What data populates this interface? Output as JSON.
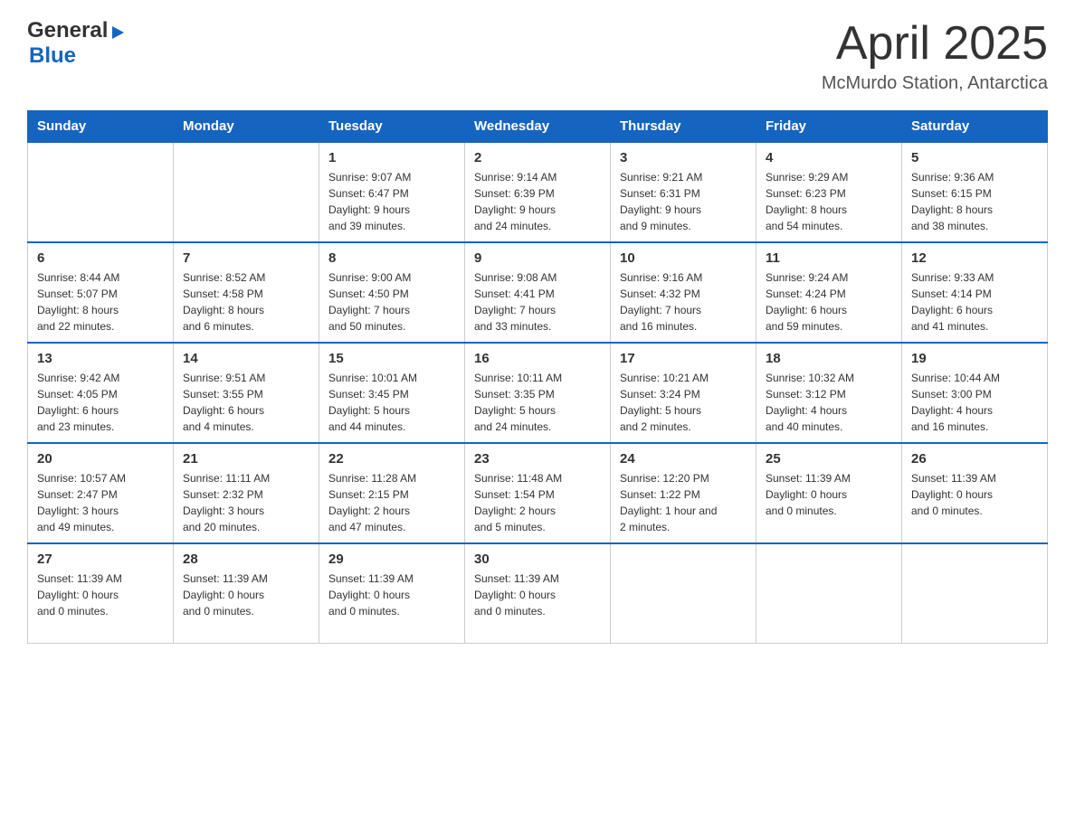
{
  "header": {
    "logo_general": "General",
    "logo_blue": "Blue",
    "title": "April 2025",
    "location": "McMurdo Station, Antarctica"
  },
  "weekdays": [
    "Sunday",
    "Monday",
    "Tuesday",
    "Wednesday",
    "Thursday",
    "Friday",
    "Saturday"
  ],
  "weeks": [
    [
      {
        "day": "",
        "info": ""
      },
      {
        "day": "",
        "info": ""
      },
      {
        "day": "1",
        "info": "Sunrise: 9:07 AM\nSunset: 6:47 PM\nDaylight: 9 hours\nand 39 minutes."
      },
      {
        "day": "2",
        "info": "Sunrise: 9:14 AM\nSunset: 6:39 PM\nDaylight: 9 hours\nand 24 minutes."
      },
      {
        "day": "3",
        "info": "Sunrise: 9:21 AM\nSunset: 6:31 PM\nDaylight: 9 hours\nand 9 minutes."
      },
      {
        "day": "4",
        "info": "Sunrise: 9:29 AM\nSunset: 6:23 PM\nDaylight: 8 hours\nand 54 minutes."
      },
      {
        "day": "5",
        "info": "Sunrise: 9:36 AM\nSunset: 6:15 PM\nDaylight: 8 hours\nand 38 minutes."
      }
    ],
    [
      {
        "day": "6",
        "info": "Sunrise: 8:44 AM\nSunset: 5:07 PM\nDaylight: 8 hours\nand 22 minutes."
      },
      {
        "day": "7",
        "info": "Sunrise: 8:52 AM\nSunset: 4:58 PM\nDaylight: 8 hours\nand 6 minutes."
      },
      {
        "day": "8",
        "info": "Sunrise: 9:00 AM\nSunset: 4:50 PM\nDaylight: 7 hours\nand 50 minutes."
      },
      {
        "day": "9",
        "info": "Sunrise: 9:08 AM\nSunset: 4:41 PM\nDaylight: 7 hours\nand 33 minutes."
      },
      {
        "day": "10",
        "info": "Sunrise: 9:16 AM\nSunset: 4:32 PM\nDaylight: 7 hours\nand 16 minutes."
      },
      {
        "day": "11",
        "info": "Sunrise: 9:24 AM\nSunset: 4:24 PM\nDaylight: 6 hours\nand 59 minutes."
      },
      {
        "day": "12",
        "info": "Sunrise: 9:33 AM\nSunset: 4:14 PM\nDaylight: 6 hours\nand 41 minutes."
      }
    ],
    [
      {
        "day": "13",
        "info": "Sunrise: 9:42 AM\nSunset: 4:05 PM\nDaylight: 6 hours\nand 23 minutes."
      },
      {
        "day": "14",
        "info": "Sunrise: 9:51 AM\nSunset: 3:55 PM\nDaylight: 6 hours\nand 4 minutes."
      },
      {
        "day": "15",
        "info": "Sunrise: 10:01 AM\nSunset: 3:45 PM\nDaylight: 5 hours\nand 44 minutes."
      },
      {
        "day": "16",
        "info": "Sunrise: 10:11 AM\nSunset: 3:35 PM\nDaylight: 5 hours\nand 24 minutes."
      },
      {
        "day": "17",
        "info": "Sunrise: 10:21 AM\nSunset: 3:24 PM\nDaylight: 5 hours\nand 2 minutes."
      },
      {
        "day": "18",
        "info": "Sunrise: 10:32 AM\nSunset: 3:12 PM\nDaylight: 4 hours\nand 40 minutes."
      },
      {
        "day": "19",
        "info": "Sunrise: 10:44 AM\nSunset: 3:00 PM\nDaylight: 4 hours\nand 16 minutes."
      }
    ],
    [
      {
        "day": "20",
        "info": "Sunrise: 10:57 AM\nSunset: 2:47 PM\nDaylight: 3 hours\nand 49 minutes."
      },
      {
        "day": "21",
        "info": "Sunrise: 11:11 AM\nSunset: 2:32 PM\nDaylight: 3 hours\nand 20 minutes."
      },
      {
        "day": "22",
        "info": "Sunrise: 11:28 AM\nSunset: 2:15 PM\nDaylight: 2 hours\nand 47 minutes."
      },
      {
        "day": "23",
        "info": "Sunrise: 11:48 AM\nSunset: 1:54 PM\nDaylight: 2 hours\nand 5 minutes."
      },
      {
        "day": "24",
        "info": "Sunrise: 12:20 PM\nSunset: 1:22 PM\nDaylight: 1 hour and\n2 minutes."
      },
      {
        "day": "25",
        "info": "Sunset: 11:39 AM\nDaylight: 0 hours\nand 0 minutes."
      },
      {
        "day": "26",
        "info": "Sunset: 11:39 AM\nDaylight: 0 hours\nand 0 minutes."
      }
    ],
    [
      {
        "day": "27",
        "info": "Sunset: 11:39 AM\nDaylight: 0 hours\nand 0 minutes."
      },
      {
        "day": "28",
        "info": "Sunset: 11:39 AM\nDaylight: 0 hours\nand 0 minutes."
      },
      {
        "day": "29",
        "info": "Sunset: 11:39 AM\nDaylight: 0 hours\nand 0 minutes."
      },
      {
        "day": "30",
        "info": "Sunset: 11:39 AM\nDaylight: 0 hours\nand 0 minutes."
      },
      {
        "day": "",
        "info": ""
      },
      {
        "day": "",
        "info": ""
      },
      {
        "day": "",
        "info": ""
      }
    ]
  ]
}
